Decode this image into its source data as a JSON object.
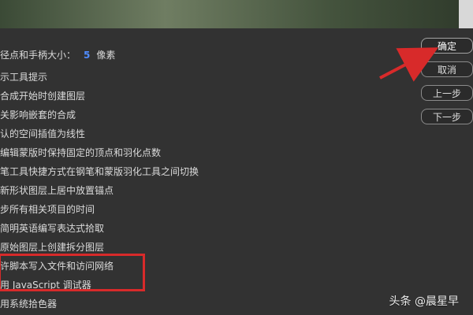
{
  "settings": [
    {
      "label": "径点和手柄大小：",
      "value": "5",
      "unit": "像素"
    },
    {
      "label": "示工具提示"
    },
    {
      "label": "合成开始时创建图层"
    },
    {
      "label": "关影响嵌套的合成"
    },
    {
      "label": "认的空间插值为线性"
    },
    {
      "label": "编辑蒙版时保持固定的顶点和羽化点数"
    },
    {
      "label": "笔工具快捷方式在钢笔和蒙版羽化工具之间切换"
    },
    {
      "label": "新形状图层上居中放置锚点"
    },
    {
      "label": "步所有相关项目的时间"
    },
    {
      "label": "简明英语编写表达式拾取"
    },
    {
      "label": "原始图层上创建拆分图层"
    },
    {
      "label": "许脚本写入文件和访问网络"
    },
    {
      "label": "用 JavaScript 调试器"
    },
    {
      "label": "用系统拾色器"
    }
  ],
  "buttons": {
    "ok": "确定",
    "cancel": "取消",
    "prev": "上一步",
    "next": "下一步"
  },
  "watermark": "头条 @晨星早",
  "colors": {
    "background": "#323232",
    "accent_value": "#4f8cff",
    "annotation": "#d82a2a"
  }
}
